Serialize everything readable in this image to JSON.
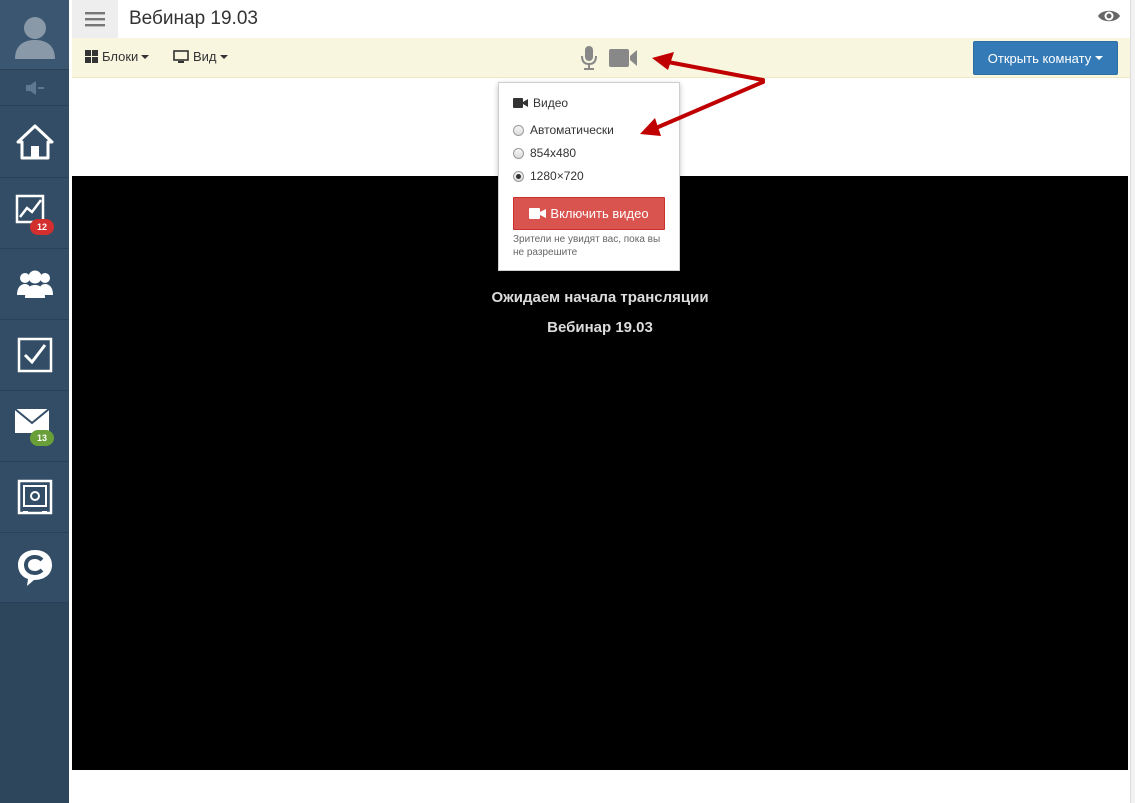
{
  "header": {
    "title": "Вебинар 19.03",
    "menu_icon": "hamburger-icon",
    "eye_icon": "eye-icon"
  },
  "toolbar": {
    "blocks_label": "Блоки",
    "view_label": "Вид",
    "open_room_label": "Открыть комнату",
    "accent": "#337ab7",
    "background": "#f8f6df"
  },
  "sidebar": {
    "background": "#324d65",
    "items": [
      {
        "icon": "avatar-icon"
      },
      {
        "icon": "speaker-icon"
      },
      {
        "icon": "home-icon"
      },
      {
        "icon": "stats-icon",
        "badge": "12",
        "badge_color": "#d32f2f"
      },
      {
        "icon": "users-icon"
      },
      {
        "icon": "checkbox-icon"
      },
      {
        "icon": "mail-icon",
        "badge": "13",
        "badge_color": "#689f38"
      },
      {
        "icon": "safe-icon"
      },
      {
        "icon": "brand-logo-icon"
      }
    ]
  },
  "popup": {
    "heading": "Видео",
    "options": [
      {
        "label": "Автоматически",
        "selected": false
      },
      {
        "label": "854x480",
        "selected": false
      },
      {
        "label": "1280×720",
        "selected": true
      }
    ],
    "enable_button_label": "Включить видео",
    "enable_button_color": "#d9534f",
    "note": "Зрители не увидят вас, пока вы не разрешите"
  },
  "video": {
    "waiting_line1": "Ожидаем начала трансляции",
    "waiting_line2": "Вебинар 19.03",
    "background": "#000000"
  },
  "annotation_color": "#c00000"
}
